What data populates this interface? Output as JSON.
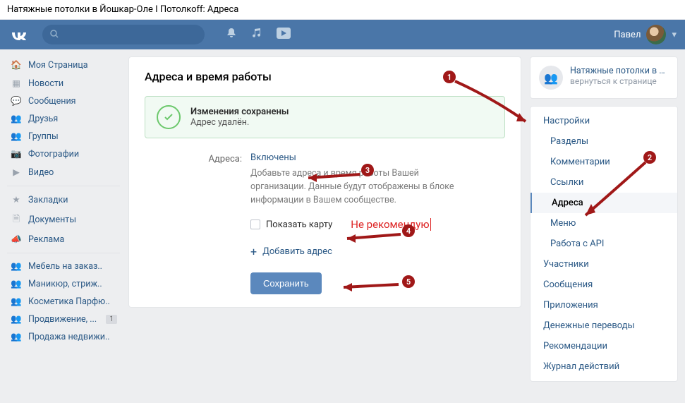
{
  "browser_title": "Натяжные потолки в Йошкар-Оле I Потолкоff: Адреса",
  "user_name": "Павел",
  "leftnav": {
    "main": [
      {
        "icon": "🏠",
        "label": "Моя Страница"
      },
      {
        "icon": "▦",
        "label": "Новости"
      },
      {
        "icon": "💬",
        "label": "Сообщения"
      },
      {
        "icon": "👥",
        "label": "Друзья"
      },
      {
        "icon": "👥",
        "label": "Группы"
      },
      {
        "icon": "📷",
        "label": "Фотографии"
      },
      {
        "icon": "▶",
        "label": "Видео"
      }
    ],
    "second": [
      {
        "icon": "★",
        "label": "Закладки"
      },
      {
        "icon": "🗎",
        "label": "Документы"
      },
      {
        "icon": "📣",
        "label": "Реклама"
      }
    ],
    "third": [
      {
        "icon": "👥",
        "label": "Мебель на заказ..",
        "badge": ""
      },
      {
        "icon": "👥",
        "label": "Маникюр, стриж..",
        "badge": ""
      },
      {
        "icon": "👥",
        "label": "Косметика Парфю..",
        "badge": ""
      },
      {
        "icon": "👥",
        "label": "Продвижение, ...",
        "badge": "1"
      },
      {
        "icon": "👥",
        "label": "Продажа недвижи..",
        "badge": ""
      }
    ]
  },
  "page": {
    "title": "Адреса и время работы",
    "alert_title": "Изменения сохранены",
    "alert_sub": "Адрес удалён.",
    "field_label": "Адреса:",
    "field_value": "Включены",
    "hint": "Добавьте адреса и время работы Вашей организации. Данные будут отображены в блоке информации в Вашем сообществе.",
    "checkbox_label": "Показать карту",
    "add_label": "Добавить адрес",
    "save_label": "Сохранить"
  },
  "annotation_text": "Не рекомендую",
  "group": {
    "name": "Натяжные потолки в Йо…",
    "back": "вернуться к странице"
  },
  "rightnav": [
    {
      "label": "Настройки",
      "sub": false,
      "active": false
    },
    {
      "label": "Разделы",
      "sub": true,
      "active": false
    },
    {
      "label": "Комментарии",
      "sub": true,
      "active": false
    },
    {
      "label": "Ссылки",
      "sub": true,
      "active": false
    },
    {
      "label": "Адреса",
      "sub": true,
      "active": true
    },
    {
      "label": "Меню",
      "sub": true,
      "active": false
    },
    {
      "label": "Работа с API",
      "sub": true,
      "active": false
    },
    {
      "label": "Участники",
      "sub": false,
      "active": false
    },
    {
      "label": "Сообщения",
      "sub": false,
      "active": false
    },
    {
      "label": "Приложения",
      "sub": false,
      "active": false
    },
    {
      "label": "Денежные переводы",
      "sub": false,
      "active": false
    },
    {
      "label": "Рекомендации",
      "sub": false,
      "active": false
    },
    {
      "label": "Журнал действий",
      "sub": false,
      "active": false
    }
  ],
  "annot_numbers": [
    "1",
    "2",
    "3",
    "4",
    "5"
  ]
}
